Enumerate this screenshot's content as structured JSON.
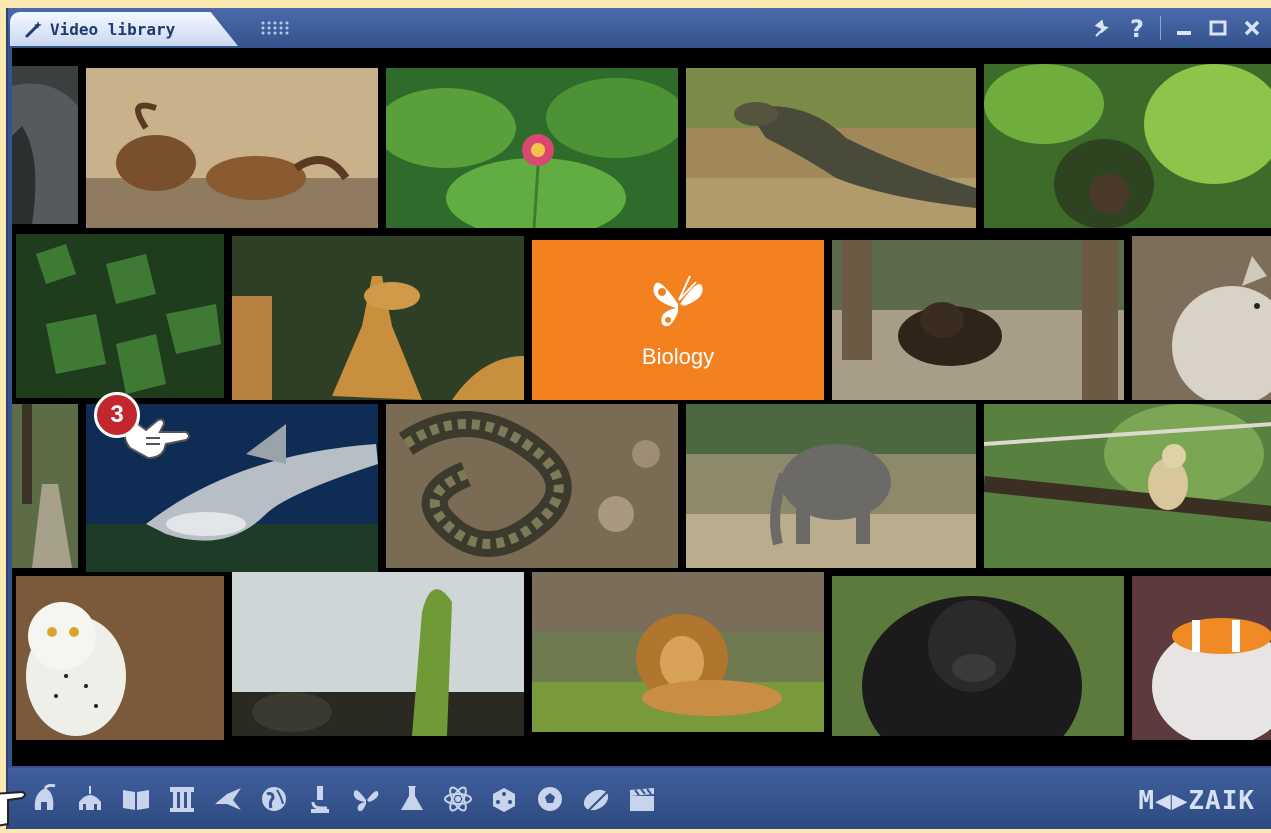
{
  "window": {
    "tab_title": "Video library",
    "tab_icon": "wand-icon",
    "controls": [
      "pin-icon",
      "help-icon",
      "minimize-icon",
      "maximize-icon",
      "close-icon"
    ]
  },
  "tiles": {
    "featured": {
      "label": "Biology",
      "icon": "butterfly-icon",
      "color": "#f4811f"
    },
    "items": [
      "rock",
      "ibex",
      "lotus",
      "komodo-dragon",
      "ghillie-soldier",
      "ivy",
      "giraffe",
      "bison",
      "wolf",
      "forest-path",
      "shark",
      "snake",
      "elephant",
      "gibbon",
      "snowy-owl",
      "plant-sprout",
      "lion",
      "gorilla",
      "clownfish"
    ]
  },
  "callout": {
    "step": "3"
  },
  "toolbar": {
    "icons": [
      "helmet-icon",
      "dome-icon",
      "book-icon",
      "column-icon",
      "origami-icon",
      "globe-icon",
      "microscope-icon",
      "butterfly-icon",
      "flask-icon",
      "atom-icon",
      "dice-icon",
      "football-icon",
      "mouse-icon",
      "clapperboard-icon"
    ],
    "logo": "M◀▶ZAIK"
  }
}
